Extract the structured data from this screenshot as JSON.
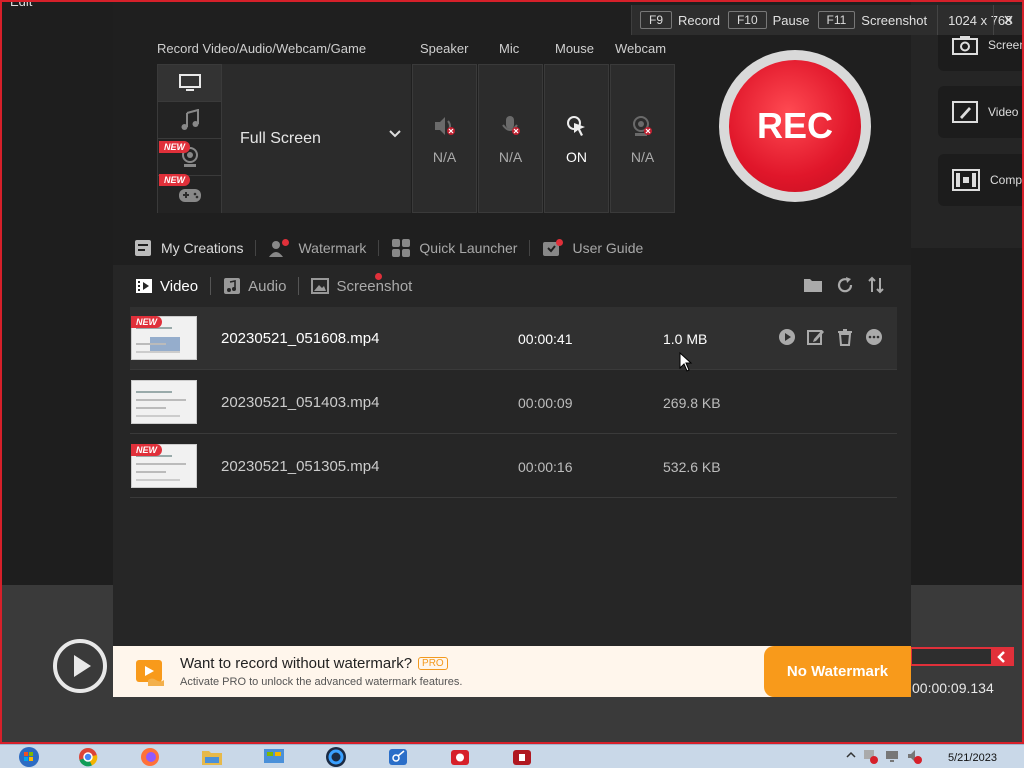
{
  "background": {
    "edit_label": "Edit",
    "side_buttons": [
      "Screen",
      "Video",
      "Comp"
    ],
    "timer": "00:00:09.134"
  },
  "hotkeys": {
    "items": [
      {
        "key": "F9",
        "label": "Record"
      },
      {
        "key": "F10",
        "label": "Pause"
      },
      {
        "key": "F11",
        "label": "Screenshot"
      }
    ],
    "resolution": "1024 x 768",
    "close": "×"
  },
  "source": {
    "header": "Record Video/Audio/Webcam/Game",
    "mode": "Full Screen",
    "new_badge": "NEW"
  },
  "devices": [
    {
      "label": "Speaker",
      "status": "N/A"
    },
    {
      "label": "Mic",
      "status": "N/A"
    },
    {
      "label": "Mouse",
      "status": "ON"
    },
    {
      "label": "Webcam",
      "status": "N/A"
    }
  ],
  "rec_label": "REC",
  "toolbar": {
    "items": [
      "My Creations",
      "Watermark",
      "Quick Launcher",
      "User Guide"
    ]
  },
  "list_tabs": [
    "Video",
    "Audio",
    "Screenshot"
  ],
  "files": [
    {
      "name": "20230521_051608.mp4",
      "duration": "00:00:41",
      "size": "1.0 MB",
      "is_new": true,
      "highlighted": true
    },
    {
      "name": "20230521_051403.mp4",
      "duration": "00:00:09",
      "size": "269.8 KB",
      "is_new": false,
      "highlighted": false
    },
    {
      "name": "20230521_051305.mp4",
      "duration": "00:00:16",
      "size": "532.6 KB",
      "is_new": true,
      "highlighted": false
    }
  ],
  "promo": {
    "title": "Want to record without watermark?",
    "pro_badge": "PRO",
    "subtitle": "Activate PRO to unlock the advanced watermark features.",
    "button": "No Watermark"
  },
  "taskbar": {
    "date": "5/21/2023"
  },
  "colors": {
    "accent_red": "#e0162a",
    "promo_orange": "#f89a1b",
    "panel_bg": "#262626"
  }
}
